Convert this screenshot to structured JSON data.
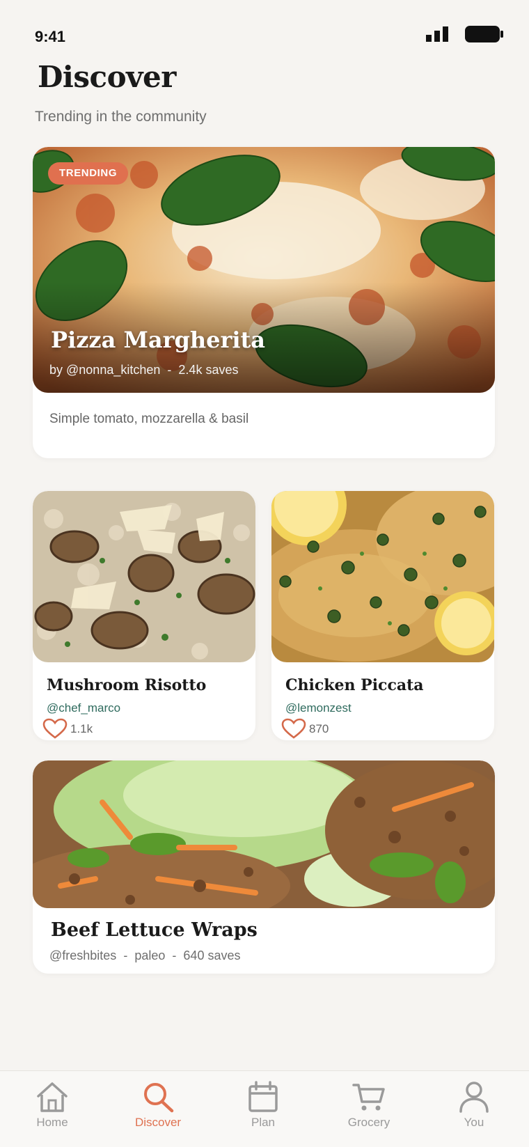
{
  "status_bar": {
    "time": "9:41"
  },
  "header": {
    "title": "Discover",
    "subtitle": "Trending in the community"
  },
  "hero": {
    "badge": "TRENDING",
    "title": "Pizza Margherita",
    "author": "by @nonna_kitchen",
    "saves": "2.4k saves",
    "description": "Simple tomato, mozzarella & basil"
  },
  "grid": [
    {
      "title": "Mushroom Risotto",
      "author": "@chef_marco",
      "likes": "1.1k"
    },
    {
      "title": "Chicken Piccata",
      "author": "@lemonzest",
      "likes": "870"
    }
  ],
  "wide": {
    "title": "Beef Lettuce Wraps",
    "author": "@freshbites",
    "tag": "paleo",
    "saves": "640 saves"
  },
  "meta_separator": "-",
  "bottom_nav": [
    {
      "label": "Home",
      "icon": "home-icon"
    },
    {
      "label": "Discover",
      "icon": "search-icon",
      "active": true
    },
    {
      "label": "Plan",
      "icon": "calendar-icon"
    },
    {
      "label": "Grocery",
      "icon": "cart-icon"
    },
    {
      "label": "You",
      "icon": "user-icon"
    }
  ],
  "colors": {
    "accent": "#e0704f",
    "author_green": "#2f6b5e",
    "background": "#f6f4f1"
  }
}
